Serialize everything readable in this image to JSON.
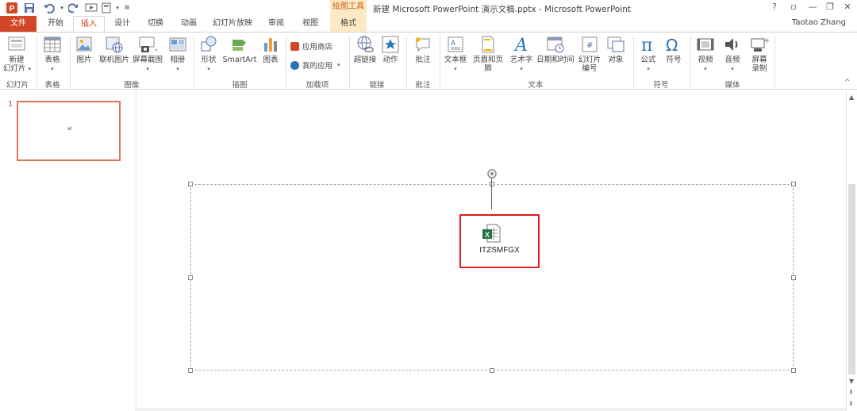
{
  "window": {
    "title": "新建 Microsoft PowerPoint 演示文稿.pptx - Microsoft PowerPoint",
    "context_group": "绘图工具",
    "user": "Taotao Zhang",
    "help": "?",
    "restore": "▫",
    "minimize": "—",
    "maximize": "❐",
    "close": "✕"
  },
  "tabs": [
    "文件",
    "开始",
    "插入",
    "设计",
    "切换",
    "动画",
    "幻灯片放映",
    "审阅",
    "视图",
    "格式"
  ],
  "active_tab": "插入",
  "ribbon": {
    "groups": [
      "幻灯片",
      "表格",
      "图像",
      "插图",
      "加载项",
      "链接",
      "批注",
      "文本",
      "符号",
      "媒体"
    ],
    "buttons": {
      "new_slide": "新建\n幻灯片",
      "table": "表格",
      "picture": "图片",
      "online_picture": "联机图片",
      "screenshot": "屏幕截图",
      "album": "相册",
      "shapes": "形状",
      "smartart": "SmartArt",
      "chart": "图表",
      "app_store": "应用商店",
      "my_apps": "我的应用",
      "hyperlink": "超链接",
      "action": "动作",
      "comment": "批注",
      "textbox": "文本框",
      "header_footer": "页眉和页脚",
      "wordart": "艺术字",
      "date_time": "日期和时间",
      "slide_number": "幻灯片\n编号",
      "object": "对象",
      "equation": "公式",
      "symbol": "符号",
      "video": "视频",
      "audio": "音频",
      "screen_record": "屏幕\n录制"
    },
    "collapse": "^"
  },
  "thumbnails": {
    "number": "1",
    "thumb_text": "xl"
  },
  "slide": {
    "object_label": "ITZSMFGX"
  },
  "colors": {
    "file_tab": "#d24726",
    "accent": "#d24726",
    "context": "#fde9c4",
    "highlight": "#e02020"
  }
}
